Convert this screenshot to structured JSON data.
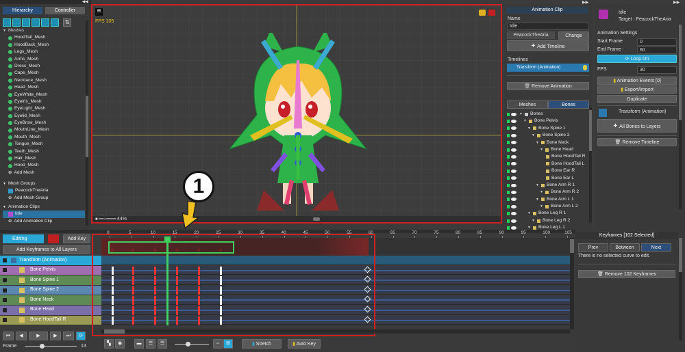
{
  "left": {
    "tabs": [
      "Hierarchy",
      "Controller"
    ],
    "meshes_header": "Meshes",
    "meshes": [
      "HoodTail_Mesh",
      "HoodBack_Mesh",
      "Legs_Mesh",
      "Arms_Mesh",
      "Dress_Mesh",
      "Cape_Mesh",
      "Necklace_Mesh",
      "Head_Mesh",
      "EyeWhite_Mesh",
      "Eyelris_Mesh",
      "EyeLight_Mesh",
      "Eyelid_Mesh",
      "EyeBrow_Mesh",
      "MouthLine_Mesh",
      "Mouth_Mesh",
      "Tongue_Mesh",
      "Teeth_Mesh",
      "Hair_Mesh",
      "Hood_Mesh"
    ],
    "add_mesh": "Add Mesh",
    "mesh_groups_header": "Mesh Groups",
    "mesh_group_item": "PeacockTheAria",
    "add_mesh_group": "Add Mesh Group",
    "anim_clips_header": "Animation Clips",
    "anim_clip_item": "Idle",
    "add_anim_clip": "Add Animation Clip"
  },
  "viewport": {
    "fps_label": "FPS 105",
    "zoom": "44%",
    "annotation_number": "1"
  },
  "timeline": {
    "editing_label": "Editing",
    "add_key": "Add Key",
    "add_keyframes_all": "Add Keyframes to All Layers",
    "ruler_ticks": [
      "0",
      "5",
      "10",
      "15",
      "20",
      "25",
      "30",
      "35",
      "40",
      "45",
      "50",
      "55",
      "60",
      "65",
      "70",
      "75",
      "80",
      "85",
      "90",
      "95",
      "100",
      "105"
    ],
    "tracks": [
      "Transform (Animation)",
      "Bone Pelvis",
      "Bone Spine 1",
      "Bone Spine 2",
      "Bone Neck",
      "Bone Head",
      "Bone HoodTail R"
    ],
    "frame_label": "Frame",
    "frame_value": "13",
    "stretch": "Stretch",
    "auto_key": "Auto Key"
  },
  "inspector": {
    "title": "Animation Clip",
    "name_label": "Name",
    "name_value": "Idle",
    "target_value": "PeacockTheAria",
    "change": "Change",
    "add_timeline": "Add Timeline",
    "timelines_label": "Timelines",
    "timeline_item": "Transform (Animation)",
    "remove_animation": "Remove Animation",
    "tabs": [
      "Meshes",
      "Bones"
    ],
    "bones": [
      {
        "name": "Bones",
        "depth": 0
      },
      {
        "name": "Bone Pelvis",
        "depth": 1
      },
      {
        "name": "Bone Spine 1",
        "depth": 2
      },
      {
        "name": "Bone Spine 2",
        "depth": 3
      },
      {
        "name": "Bone Neck",
        "depth": 4
      },
      {
        "name": "Bone Head",
        "depth": 5
      },
      {
        "name": "Bone HoodTail R",
        "depth": 6
      },
      {
        "name": "Bone HoodTail L",
        "depth": 6
      },
      {
        "name": "Bone Ear R",
        "depth": 6
      },
      {
        "name": "Bone Ear L",
        "depth": 6
      },
      {
        "name": "Bone Arm R 1",
        "depth": 4
      },
      {
        "name": "Bone Arm R 2",
        "depth": 5
      },
      {
        "name": "Bone Arm L 1",
        "depth": 4
      },
      {
        "name": "Bone Arm L 2",
        "depth": 5
      },
      {
        "name": "Bone Leg R 1",
        "depth": 2
      },
      {
        "name": "Bone Leg R 2",
        "depth": 3
      },
      {
        "name": "Bone Leg L 1",
        "depth": 2
      }
    ]
  },
  "right": {
    "clip_name": "Idle",
    "target": "Target : PeacockTheAria",
    "settings_label": "Animation Settings",
    "start_frame_label": "Start Frame",
    "start_frame": "0",
    "end_frame_label": "End Frame",
    "end_frame": "60",
    "loop_on": "Loop On",
    "fps_label": "FPS",
    "fps_value": "30",
    "anim_events": "Animation Events [0]",
    "export_import": "Export/Import",
    "duplicate": "Duplicate",
    "transform_label": "Transform (Animation)",
    "all_bones": "All Bones to Layers",
    "remove_timeline": "Remove Timeline",
    "keyframes_title": "Keyframes [102 Selected]",
    "prev": "Prev",
    "between": "Between",
    "next": "Next",
    "no_curve": "There is no selected curve to edit.",
    "remove_keyframes": "Remove 102 Keyframes"
  },
  "colors": {
    "accent": "#2aa9d8",
    "highlight_red": "#e0302f",
    "key_red": "#e33"
  }
}
